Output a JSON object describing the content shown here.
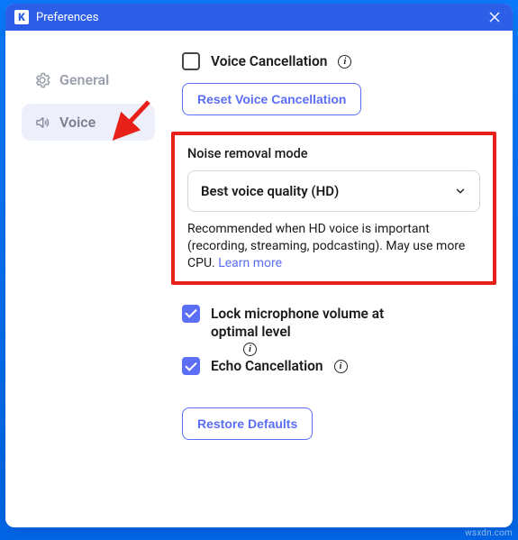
{
  "titlebar": {
    "title": "Preferences",
    "app_glyph": "K"
  },
  "sidebar": {
    "general": {
      "label": "General"
    },
    "voice": {
      "label": "Voice"
    }
  },
  "voice_cancel": {
    "label": "Voice Cancellation",
    "reset_btn": "Reset Voice Cancellation"
  },
  "noise": {
    "field_label": "Noise removal mode",
    "selected": "Best voice quality (HD)",
    "desc": "Recommended when HD voice is important (recording, streaming, podcasting). May use more CPU. ",
    "learn_more": "Learn more"
  },
  "lock_mic": {
    "label": "Lock microphone volume at optimal level"
  },
  "echo": {
    "label": "Echo Cancellation"
  },
  "restore": {
    "label": "Restore Defaults"
  },
  "watermark": "wsxdn.com"
}
